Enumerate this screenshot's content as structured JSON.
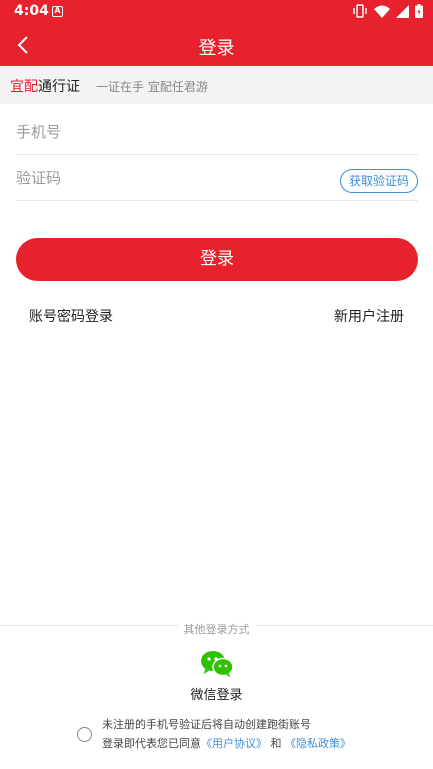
{
  "status_bar": {
    "time": "4:04",
    "notification_icon": "A"
  },
  "app_bar": {
    "title": "登录",
    "back_icon": "chevron-left-icon"
  },
  "brand": {
    "name_red": "宜配",
    "name_rest": "通行证",
    "slogan": "一证在手 宜配任君游"
  },
  "form": {
    "phone_placeholder": "手机号",
    "code_placeholder": "验证码",
    "get_code_label": "获取验证码",
    "login_label": "登录"
  },
  "links": {
    "password_login": "账号密码登录",
    "register": "新用户注册"
  },
  "other_login": {
    "title": "其他登录方式",
    "wechat_label": "微信登录",
    "wechat_icon": "wechat-icon",
    "wechat_color": "#2dc100"
  },
  "agreement": {
    "line1": "未注册的手机号验证后将自动创建跑街账号",
    "line2_prefix": "登录即代表您已同意",
    "user_agreement": "《用户协议》",
    "and": "和",
    "privacy_policy": "《隐私政策》"
  },
  "colors": {
    "primary": "#e8222c",
    "link": "#3d8fd6"
  }
}
